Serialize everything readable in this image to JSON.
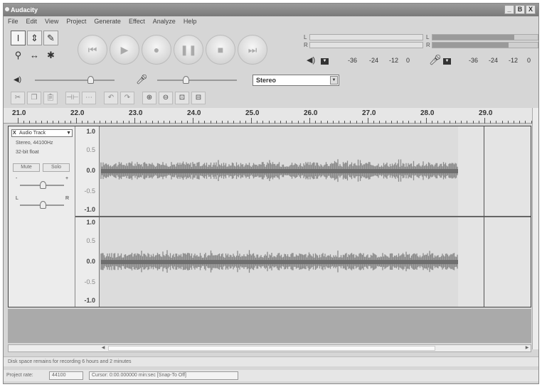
{
  "window": {
    "title": "Audacity",
    "buttons": [
      "_",
      "B",
      "X"
    ]
  },
  "menu": [
    "File",
    "Edit",
    "View",
    "Project",
    "Generate",
    "Effect",
    "Analyze",
    "Help"
  ],
  "meters": {
    "play_label": "L",
    "play_label_r": "R",
    "rec_label": "L",
    "rec_label_r": "R",
    "play_ticks": [
      "-36",
      "-24",
      "-12",
      "0"
    ],
    "rec_ticks": [
      "-36",
      "-24",
      "-12",
      "0"
    ],
    "rec_level_l": 0.78,
    "rec_level_r": 0.72
  },
  "mixer": {
    "input_source": "Stereo"
  },
  "ruler": {
    "labels": [
      "21.0",
      "22.0",
      "23.0",
      "24.0",
      "25.0",
      "26.0",
      "27.0",
      "28.0",
      "29.0"
    ]
  },
  "track": {
    "name": "Audio Track",
    "close": "X",
    "rate": "Stereo, 44100Hz",
    "format": "32-bit float",
    "mute": "Mute",
    "solo": "Solo",
    "pan_l": "L",
    "pan_r": "R",
    "gain_minus": "-",
    "gain_plus": "+",
    "y_ticks": [
      "1.0",
      "0.5",
      "0.0",
      "-0.5",
      "-1.0"
    ]
  },
  "status": {
    "disk": "Disk space remains for recording 6 hours and 2 minutes",
    "rate_label": "Project rate:",
    "rate_value": "44100",
    "cursor": "Cursor: 0:00.000000 min:sec",
    "snap": "[Snap-To Off]"
  },
  "colors": {
    "waveform": "#8a8a8a",
    "background": "#d6d6d6"
  }
}
